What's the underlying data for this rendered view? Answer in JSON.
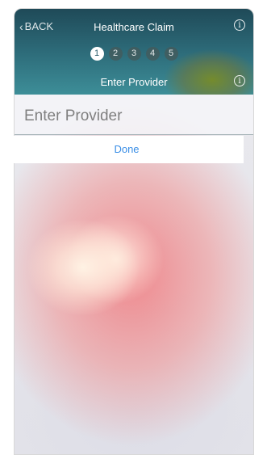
{
  "header": {
    "back_label": "BACK",
    "title": "Healthcare Claim",
    "subtitle": "Enter Provider",
    "steps": [
      "1",
      "2",
      "3",
      "4",
      "5"
    ],
    "active_step": "1",
    "info_icon_glyph": "i"
  },
  "form": {
    "provider_placeholder": "Enter Provider",
    "provider_value": "",
    "done_label": "Done"
  },
  "colors": {
    "header_top": "#1f4a58",
    "header_bottom": "#3d8e98",
    "done_text": "#3a8ee6"
  }
}
